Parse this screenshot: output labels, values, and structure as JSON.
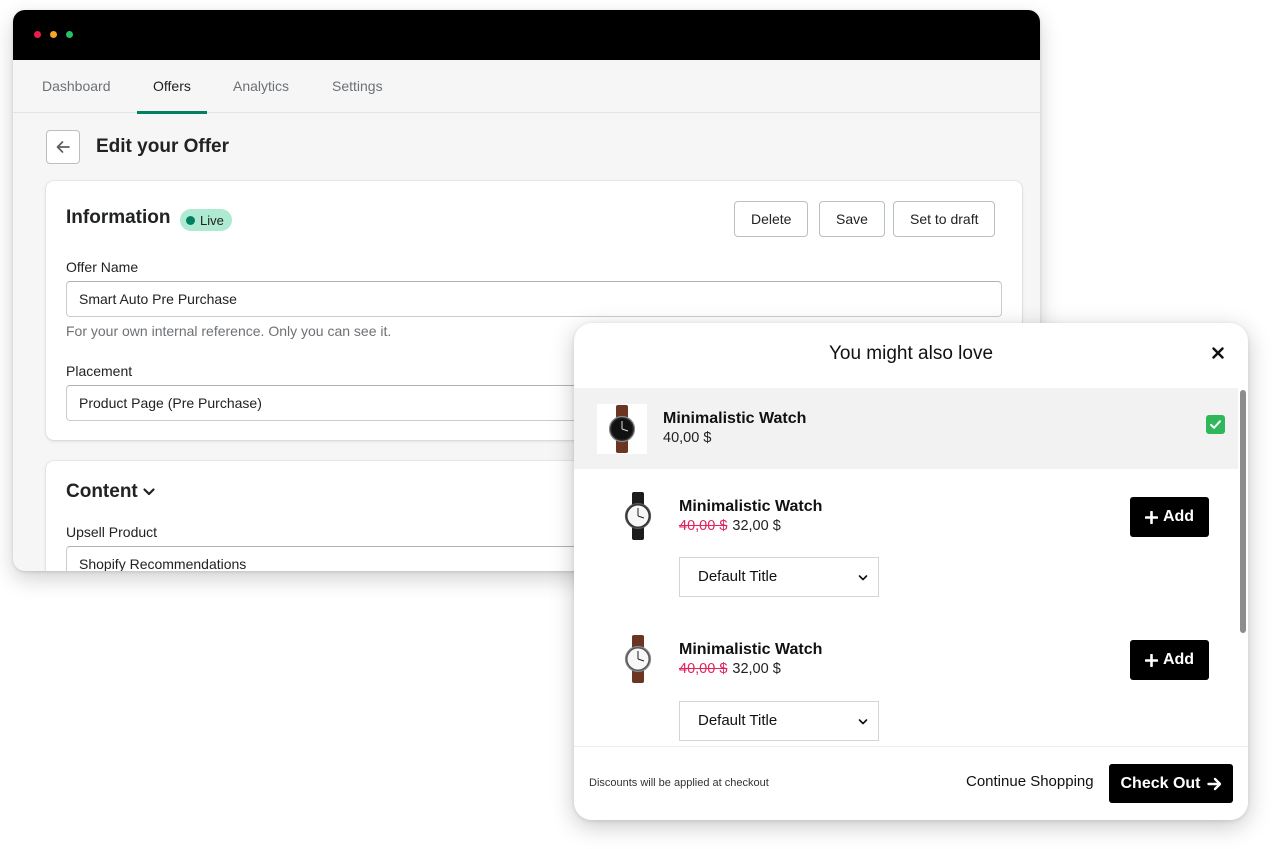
{
  "admin": {
    "nav_tabs": [
      {
        "label": "Dashboard",
        "active": false
      },
      {
        "label": "Offers",
        "active": true
      },
      {
        "label": "Analytics",
        "active": false
      },
      {
        "label": "Settings",
        "active": false
      }
    ],
    "page_title": "Edit your Offer",
    "information": {
      "heading": "Information",
      "status_badge": "Live",
      "buttons": {
        "delete": "Delete",
        "save": "Save",
        "draft": "Set to draft"
      },
      "offer_name_label": "Offer Name",
      "offer_name_value": "Smart Auto Pre Purchase",
      "offer_name_help": "For your own internal reference. Only you can see it.",
      "placement_label": "Placement",
      "placement_value": "Product Page (Pre Purchase)"
    },
    "content": {
      "heading": "Content",
      "upsell_label": "Upsell Product",
      "upsell_value": "Shopify Recommendations"
    },
    "colors": {
      "accent": "#008060",
      "badge_bg": "#aee9d1",
      "badge_dot": "#007f5f"
    }
  },
  "modal": {
    "title": "You might also love",
    "items": [
      {
        "name": "Minimalistic Watch",
        "price": "40,00 $",
        "selected": true,
        "strap": "brown",
        "dial": "black"
      },
      {
        "name": "Minimalistic Watch",
        "old_price": "40,00 $",
        "price": "32,00 $",
        "add_label": "Add",
        "variant": "Default Title",
        "strap": "black",
        "dial": "white"
      },
      {
        "name": "Minimalistic Watch",
        "old_price": "40,00 $",
        "price": "32,00 $",
        "add_label": "Add",
        "variant": "Default Title",
        "strap": "brown",
        "dial": "white"
      }
    ],
    "footer": {
      "note": "Discounts will be applied at checkout",
      "continue_label": "Continue Shopping",
      "checkout_label": "Check Out"
    },
    "colors": {
      "checkbox": "#2fb75b",
      "old_price": "#e0245e",
      "button": "#000000"
    }
  }
}
